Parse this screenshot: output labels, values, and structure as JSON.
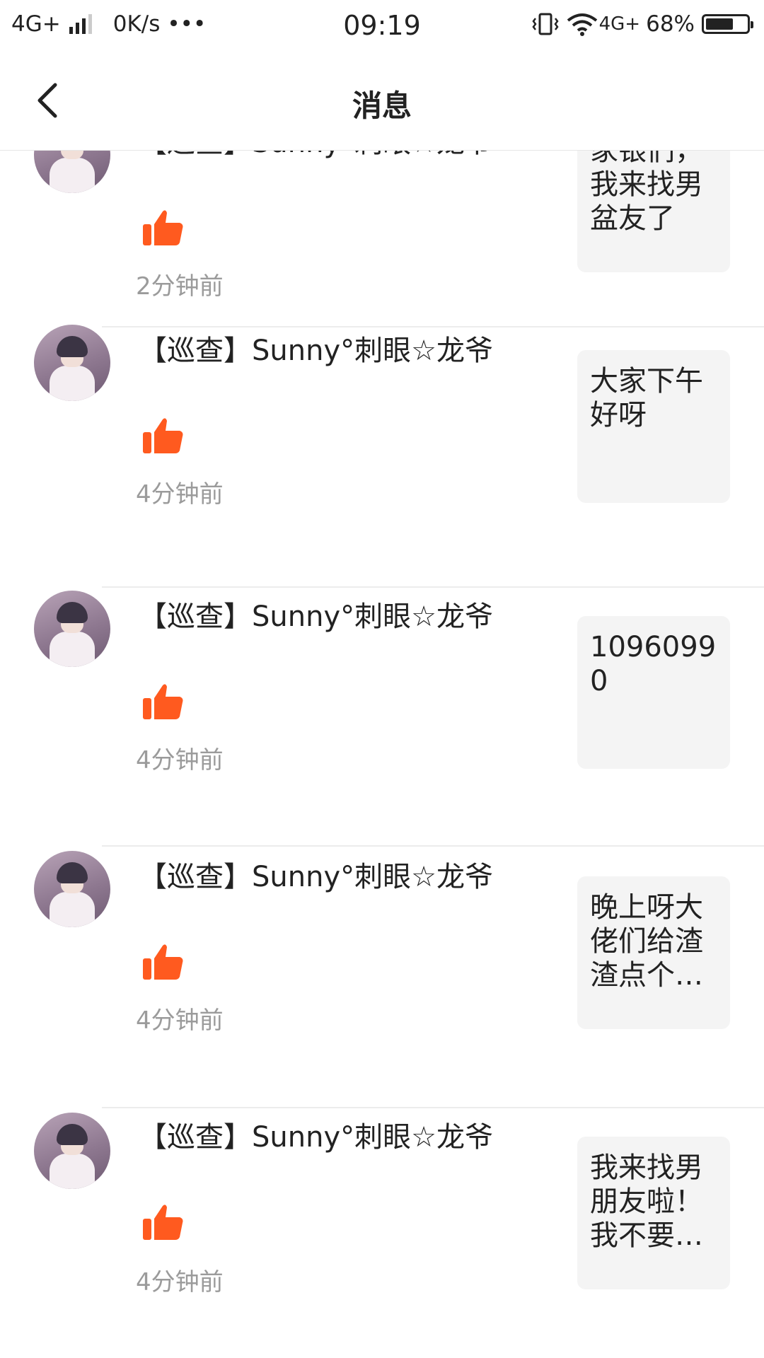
{
  "status_bar": {
    "network": "4G+",
    "speed": "0K/s",
    "dots": "•••",
    "time": "09:19",
    "network_right": "4G+",
    "battery": "68%",
    "battery_level": 0.68
  },
  "nav": {
    "title": "消息",
    "back_icon": "chevron-left-icon"
  },
  "messages": [
    {
      "name": "【巡查】Sunny°刺眼☆龙爷",
      "time": "2分钟前",
      "preview": "家银们，我来找男盆友了"
    },
    {
      "name": "【巡查】Sunny°刺眼☆龙爷",
      "time": "4分钟前",
      "preview": "大家下午好呀"
    },
    {
      "name": "【巡查】Sunny°刺眼☆龙爷",
      "time": "4分钟前",
      "preview": "10960990"
    },
    {
      "name": "【巡查】Sunny°刺眼☆龙爷",
      "time": "4分钟前",
      "preview": "晚上呀大佬们给渣渣点个…"
    },
    {
      "name": "【巡查】Sunny°刺眼☆龙爷",
      "time": "4分钟前",
      "preview": "我来找男朋友啦！我不要…"
    }
  ],
  "colors": {
    "like": "#ff5a1f",
    "preview_bg": "#f4f4f4",
    "time_text": "#9b9b9b"
  }
}
